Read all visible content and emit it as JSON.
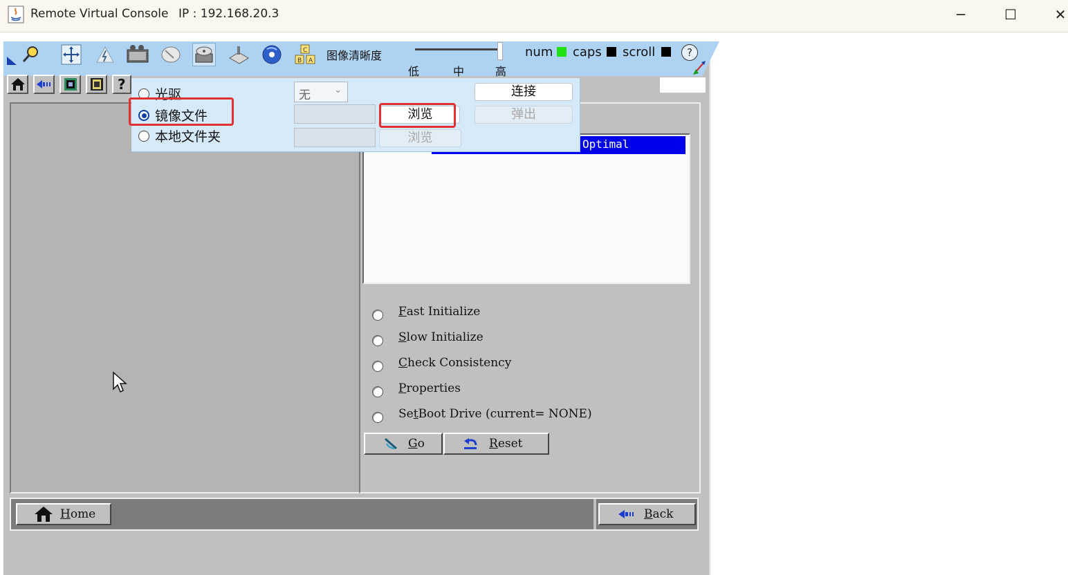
{
  "window": {
    "title": "Remote Virtual Console",
    "ip": "IP : 192.168.20.3",
    "minimize_glyph": "─",
    "maximize_glyph": "☐",
    "close_glyph": "✕"
  },
  "kvm_toolbar": {
    "icons": [
      "connect-icon",
      "move-icon",
      "power-icon",
      "video-record-icon",
      "mouse-icon",
      "virtual-media-icon",
      "keyboard-icon",
      "cd-icon",
      "language-icon"
    ],
    "clarity_label": "图像清晰度",
    "clarity_ticks": [
      "低",
      "中",
      "高"
    ],
    "clarity_level": "高",
    "num_label": "num",
    "caps_label": "caps",
    "scroll_label": "scroll",
    "help_glyph": "?",
    "colors": {
      "bar": "#aed3f2",
      "num_on": "#22e010",
      "led_off": "#000000"
    }
  },
  "media_popup": {
    "options": [
      {
        "label": "光驱",
        "selected": false
      },
      {
        "label": "镜像文件",
        "selected": true
      },
      {
        "label": "本地文件夹",
        "selected": false
      }
    ],
    "drive_select": "无",
    "browse_label": "浏览",
    "connect_label": "连接",
    "eject_label": "弹出"
  },
  "bios_page": {
    "selected_item": "Optimal",
    "list_dots": "·  ·",
    "actions": [
      {
        "hotkey": "F",
        "rest": "ast Initialize"
      },
      {
        "hotkey": "S",
        "rest": "low Initialize"
      },
      {
        "hotkey": "C",
        "rest": "heck Consistency"
      },
      {
        "hotkey": "P",
        "rest": "roperties"
      },
      {
        "prefix": "Se",
        "hotkey": "t",
        "rest": " Boot Drive (current= NONE)"
      }
    ],
    "go": {
      "hotkey": "G",
      "rest": "o"
    },
    "reset": {
      "hotkey": "R",
      "rest": "eset"
    },
    "home": {
      "hotkey": "H",
      "rest": "ome"
    },
    "back": {
      "hotkey": "B",
      "rest": "ack"
    }
  }
}
